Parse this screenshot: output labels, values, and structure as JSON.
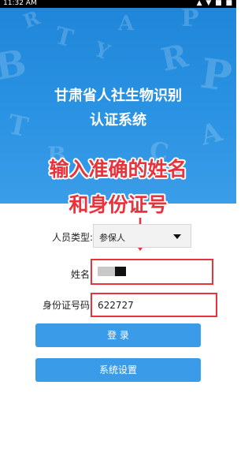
{
  "status_bar": {
    "time": "11:32 AM",
    "indicators": "▲ ▼ ■ ■"
  },
  "hero": {
    "title_line1": "甘肃省人社生物识别",
    "title_line2": "认证系统",
    "letters": [
      "B",
      "T",
      "A",
      "R",
      "P",
      "Y",
      "T",
      "A",
      "B",
      "C",
      "P",
      "R"
    ]
  },
  "annotation": {
    "line1": "输入准确的姓名",
    "line2": "和身份证号",
    "color": "#e8323c"
  },
  "form": {
    "person_type_label": "人员类型:",
    "person_type_value": "参保人",
    "name_label": "姓名:",
    "name_value": "",
    "id_label": "身份证号码:",
    "id_value": "622727"
  },
  "buttons": {
    "login": "登 录",
    "settings": "系统设置"
  },
  "colors": {
    "hero_blue": "#2b93e3",
    "button_blue": "#3a9be8"
  }
}
